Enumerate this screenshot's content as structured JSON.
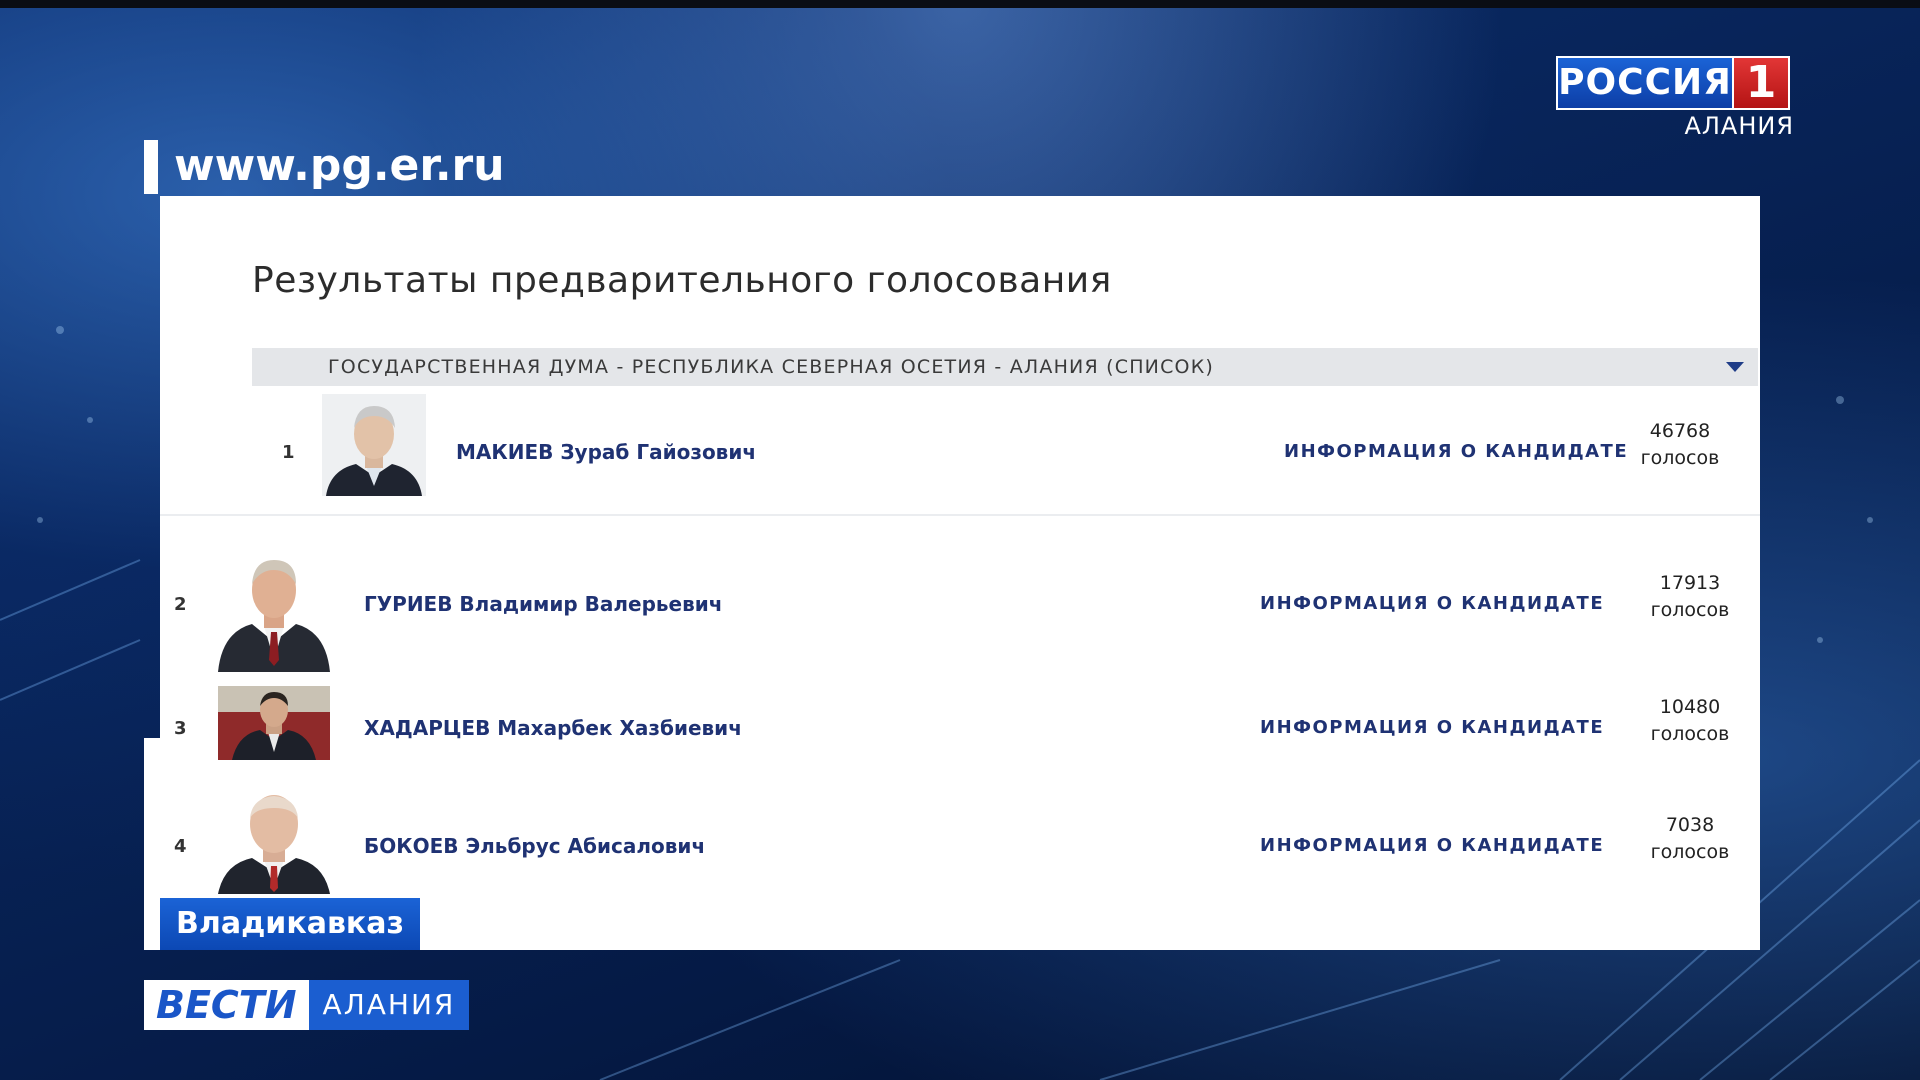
{
  "broadcaster": {
    "channel_name": "РОССИЯ",
    "channel_number": "1",
    "region": "АЛАНИЯ",
    "colors": {
      "blue": "#1b63d6",
      "red": "#d32626"
    }
  },
  "source_caption": {
    "url": "www.pg.er.ru"
  },
  "page": {
    "title": "Результаты предварительного голосования",
    "list_select": {
      "selected": "ГОСУДАРСТВЕННАЯ ДУМА - РЕСПУБЛИКА СЕВЕРНАЯ ОСЕТИЯ - АЛАНИЯ (СПИСОК)",
      "icon": "chevron-down-icon"
    },
    "candidates": [
      {
        "rank": "1",
        "name": "МАКИЕВ Зураб Гайозович",
        "info_link": "ИНФОРМАЦИЯ О КАНДИДАТЕ",
        "votes": "46768",
        "votes_unit": "голосов"
      },
      {
        "rank": "2",
        "name": "ГУРИЕВ Владимир Валерьевич",
        "info_link": "ИНФОРМАЦИЯ О КАНДИДАТЕ",
        "votes": "17913",
        "votes_unit": "голосов"
      },
      {
        "rank": "3",
        "name": "ХАДАРЦЕВ Махарбек Хазбиевич",
        "info_link": "ИНФОРМАЦИЯ О КАНДИДАТЕ",
        "votes": "10480",
        "votes_unit": "голосов"
      },
      {
        "rank": "4",
        "name": "БОКОЕВ Эльбрус Абисалович",
        "info_link": "ИНФОРМАЦИЯ О КАНДИДАТЕ",
        "votes": "7038",
        "votes_unit": "голосов"
      }
    ]
  },
  "location_caption": {
    "city": "Владикавказ"
  },
  "program": {
    "name": "ВЕСТИ",
    "region": "АЛАНИЯ"
  }
}
